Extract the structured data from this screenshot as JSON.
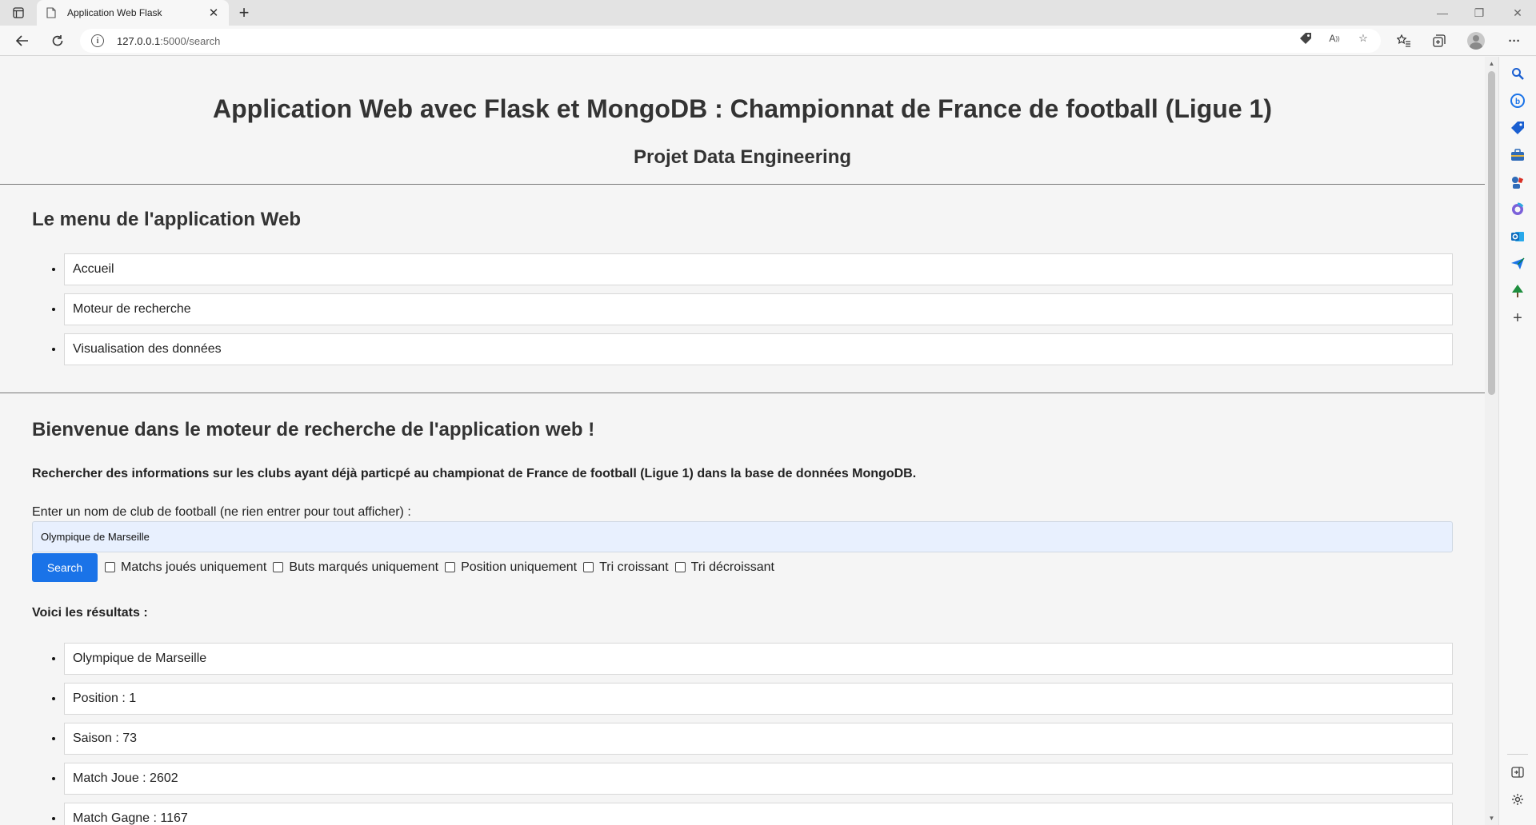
{
  "browser": {
    "tab_title": "Application Web Flask",
    "url_host": "127.0.0.1",
    "url_path": ":5000/search"
  },
  "page": {
    "title": "Application Web avec Flask et MongoDB : Championnat de France de football (Ligue 1)",
    "subtitle": "Projet Data Engineering"
  },
  "menu": {
    "title": "Le menu de l'application Web",
    "items": [
      "Accueil",
      "Moteur de recherche",
      "Visualisation des données"
    ]
  },
  "search": {
    "title": "Bienvenue dans le moteur de recherche de l'application web !",
    "description": "Rechercher des informations sur les clubs ayant déjà particpé au championat de France de football (Ligue 1) dans la base de données MongoDB.",
    "label": "Enter un nom de club de football (ne rien entrer pour tout afficher) :",
    "value": "Olympique de Marseille",
    "button": "Search",
    "options": [
      "Matchs joués uniquement",
      "Buts marqués uniquement",
      "Position uniquement",
      "Tri croissant",
      "Tri décroissant"
    ]
  },
  "results": {
    "title": "Voici les résultats :",
    "items": [
      "Olympique de Marseille",
      "Position : 1",
      "Saison : 73",
      "Match Joue : 2602",
      "Match Gagne : 1167"
    ]
  },
  "colors": {
    "accent": "#1a73e8",
    "input_bg": "#e8f0fe"
  }
}
